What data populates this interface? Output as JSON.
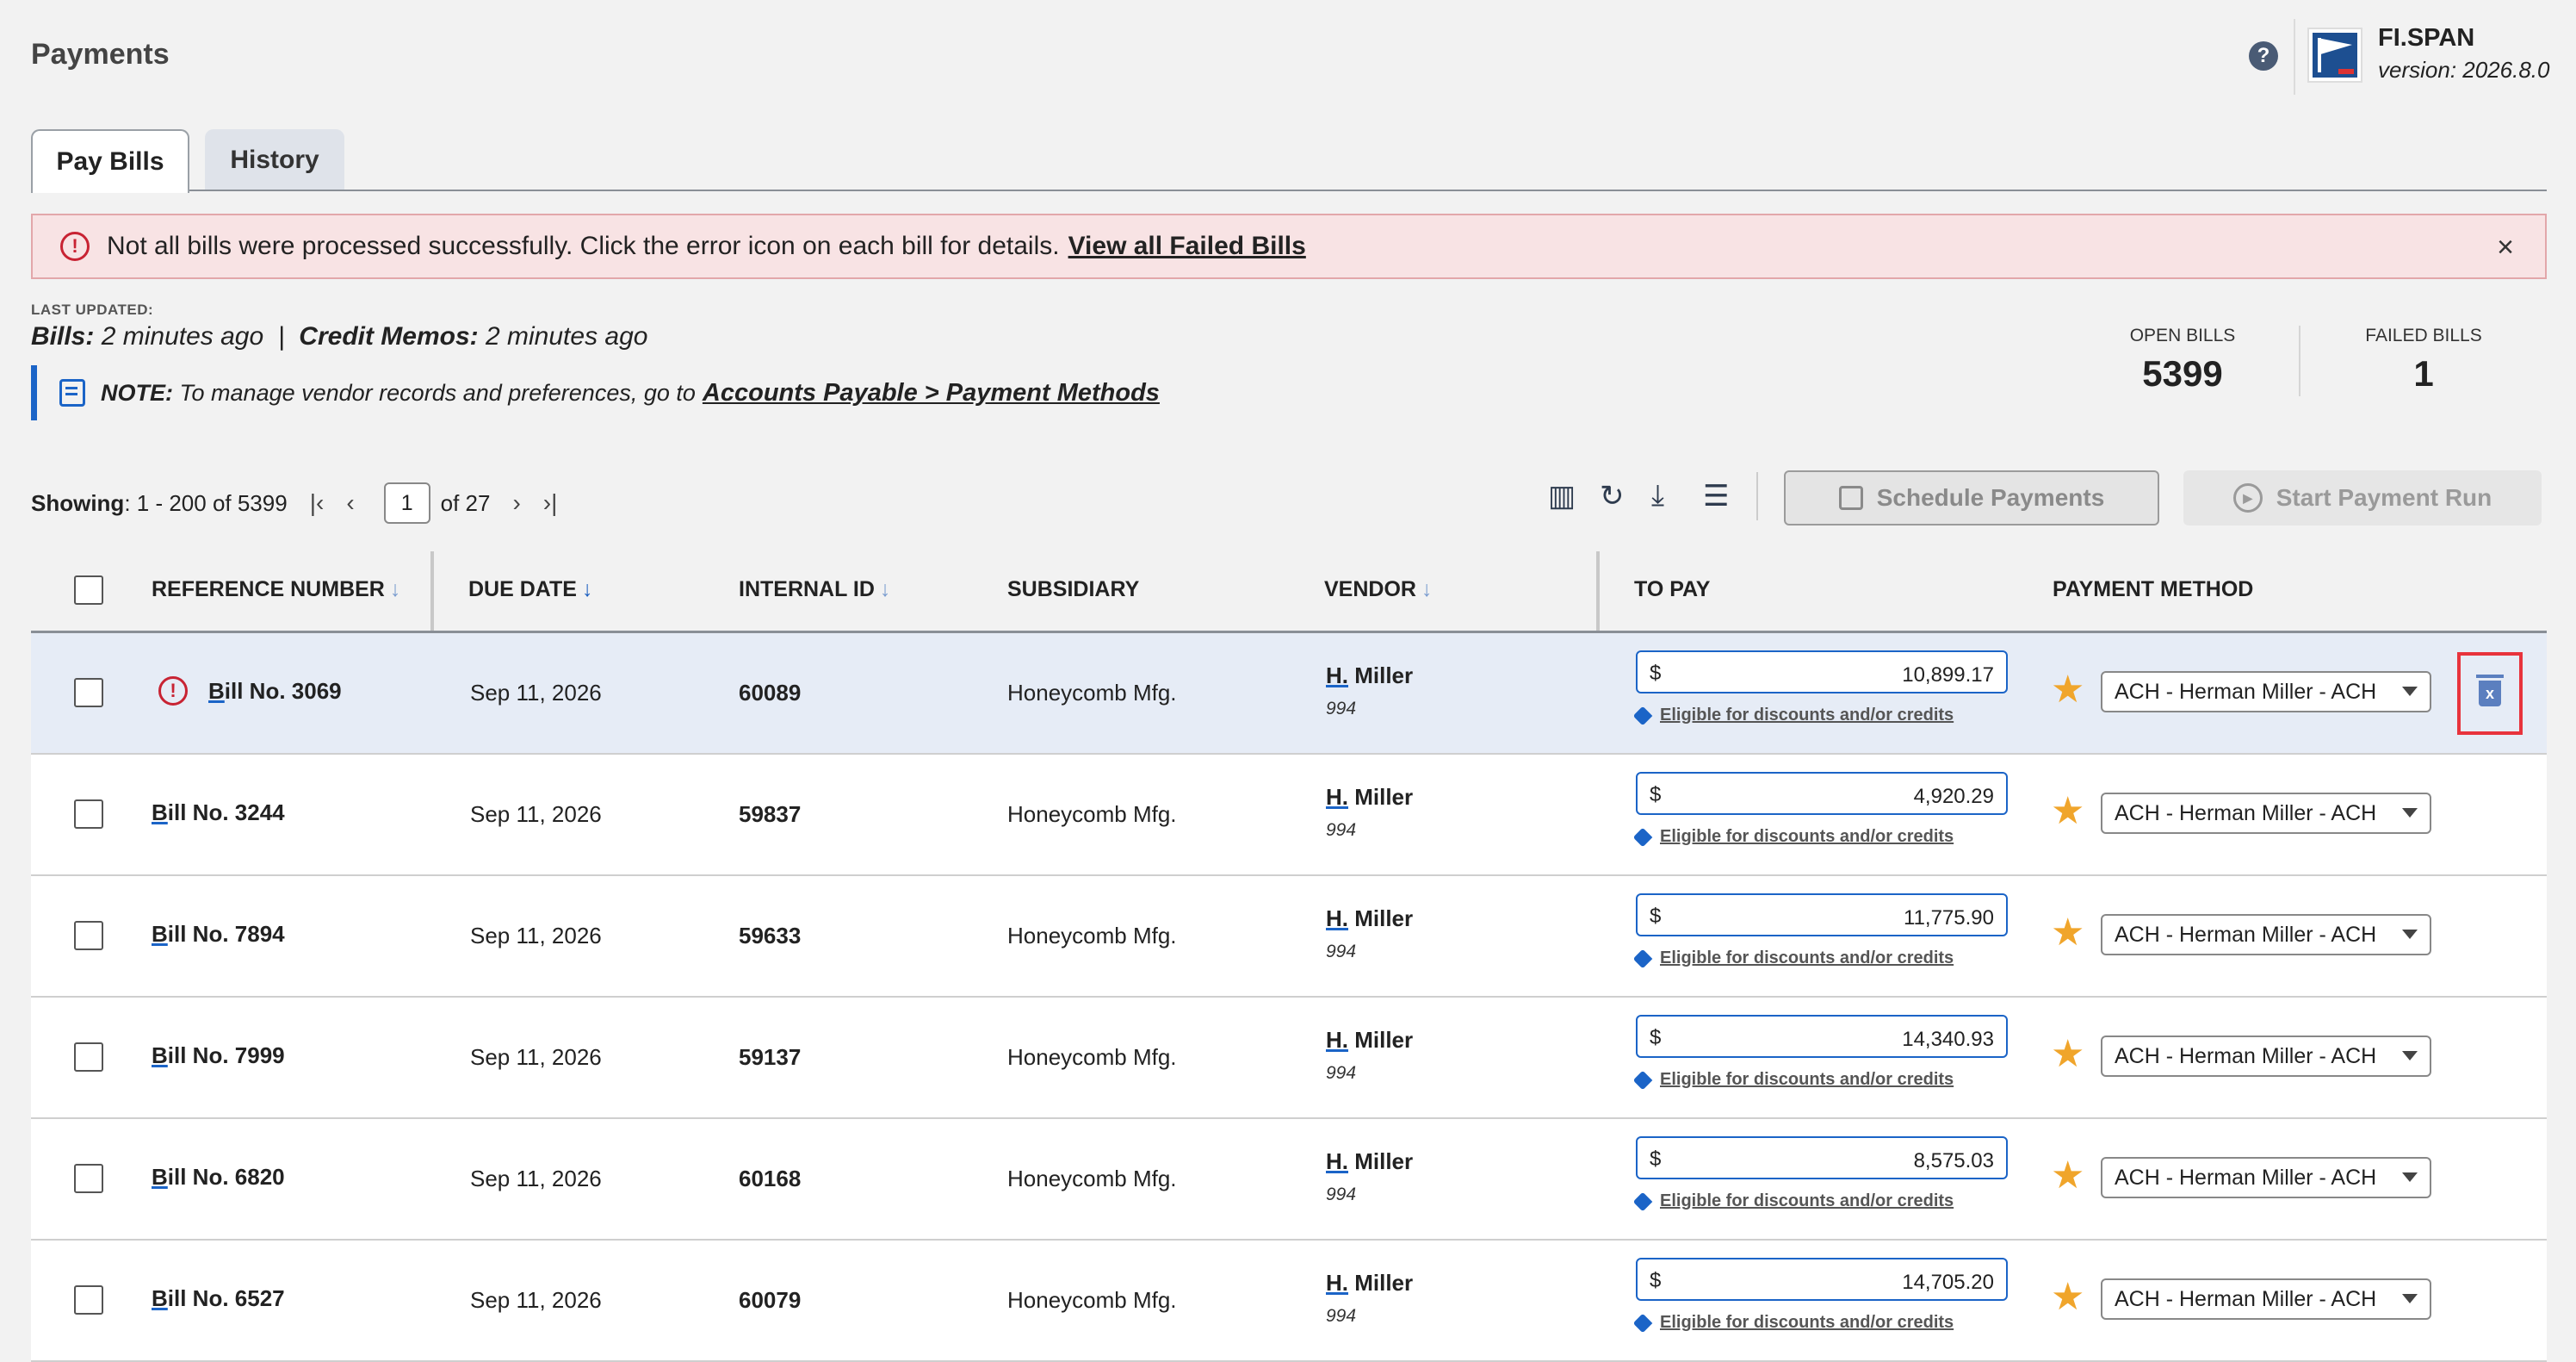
{
  "header": {
    "title": "Payments",
    "help_icon": "?",
    "brand_name": "FI.SPAN",
    "version": "version: 2026.8.0"
  },
  "tabs": [
    {
      "label": "Pay Bills",
      "active": true
    },
    {
      "label": "History",
      "active": false
    }
  ],
  "alert": {
    "icon": "!",
    "message": "Not all bills were processed successfully. Click the error icon on each bill for details.",
    "link": "View all Failed Bills",
    "close": "×"
  },
  "last_updated": {
    "label": "LAST UPDATED:",
    "bills_label": "Bills:",
    "bills_value": "2 minutes ago",
    "sep": "|",
    "credit_label": "Credit Memos:",
    "credit_value": "2 minutes ago"
  },
  "note": {
    "label": "NOTE:",
    "text": "To manage vendor records and preferences, go to",
    "link": "Accounts Payable > Payment Methods"
  },
  "stats": {
    "open_label": "OPEN BILLS",
    "open_value": "5399",
    "failed_label": "FAILED BILLS",
    "failed_value": "1"
  },
  "pager": {
    "showing_label": "Showing",
    "showing_range": ": 1 - 200 of 5399",
    "page": "1",
    "of": "of 27",
    "first": "|‹",
    "prev": "‹",
    "next": "›",
    "last": "›|"
  },
  "toolbar": {
    "columns_icon": "▥",
    "refresh_icon": "↻",
    "download_icon": "⤓",
    "filter_icon": "☰",
    "schedule": "Schedule Payments",
    "start": "Start Payment Run"
  },
  "columns": {
    "ref": "REFERENCE NUMBER",
    "due": "DUE DATE",
    "internal": "INTERNAL ID",
    "subsidiary": "SUBSIDIARY",
    "vendor": "VENDOR",
    "to_pay": "TO PAY",
    "method": "PAYMENT METHOD",
    "sort_arrow": "↓"
  },
  "rows": [
    {
      "b": "B",
      "ref": "ill No. 3069",
      "due": "Sep 11, 2026",
      "id": "60089",
      "sub": "Honeycomb Mfg.",
      "vb": "H.",
      "vendor": " Miller",
      "vid": "994",
      "cur": "$",
      "amount": "10,899.17",
      "discount": "Eligible for discounts and/or credits",
      "star": "★",
      "method": "ACH - Herman Miller - ACH",
      "error": "!"
    },
    {
      "b": "B",
      "ref": "ill No. 3244",
      "due": "Sep 11, 2026",
      "id": "59837",
      "sub": "Honeycomb Mfg.",
      "vb": "H.",
      "vendor": " Miller",
      "vid": "994",
      "cur": "$",
      "amount": "4,920.29",
      "discount": "Eligible for discounts and/or credits",
      "star": "★",
      "method": "ACH - Herman Miller - ACH"
    },
    {
      "b": "B",
      "ref": "ill No. 7894",
      "due": "Sep 11, 2026",
      "id": "59633",
      "sub": "Honeycomb Mfg.",
      "vb": "H.",
      "vendor": " Miller",
      "vid": "994",
      "cur": "$",
      "amount": "11,775.90",
      "discount": "Eligible for discounts and/or credits",
      "star": "★",
      "method": "ACH - Herman Miller - ACH"
    },
    {
      "b": "B",
      "ref": "ill No. 7999",
      "due": "Sep 11, 2026",
      "id": "59137",
      "sub": "Honeycomb Mfg.",
      "vb": "H.",
      "vendor": " Miller",
      "vid": "994",
      "cur": "$",
      "amount": "14,340.93",
      "discount": "Eligible for discounts and/or credits",
      "star": "★",
      "method": "ACH - Herman Miller - ACH"
    },
    {
      "b": "B",
      "ref": "ill No. 6820",
      "due": "Sep 11, 2026",
      "id": "60168",
      "sub": "Honeycomb Mfg.",
      "vb": "H.",
      "vendor": " Miller",
      "vid": "994",
      "cur": "$",
      "amount": "8,575.03",
      "discount": "Eligible for discounts and/or credits",
      "star": "★",
      "method": "ACH - Herman Miller - ACH"
    },
    {
      "b": "B",
      "ref": "ill No. 6527",
      "due": "Sep 11, 2026",
      "id": "60079",
      "sub": "Honeycomb Mfg.",
      "vb": "H.",
      "vendor": " Miller",
      "vid": "994",
      "cur": "$",
      "amount": "14,705.20",
      "discount": "Eligible for discounts and/or credits",
      "star": "★",
      "method": "ACH - Herman Miller - ACH"
    }
  ],
  "remove_icon": "x"
}
